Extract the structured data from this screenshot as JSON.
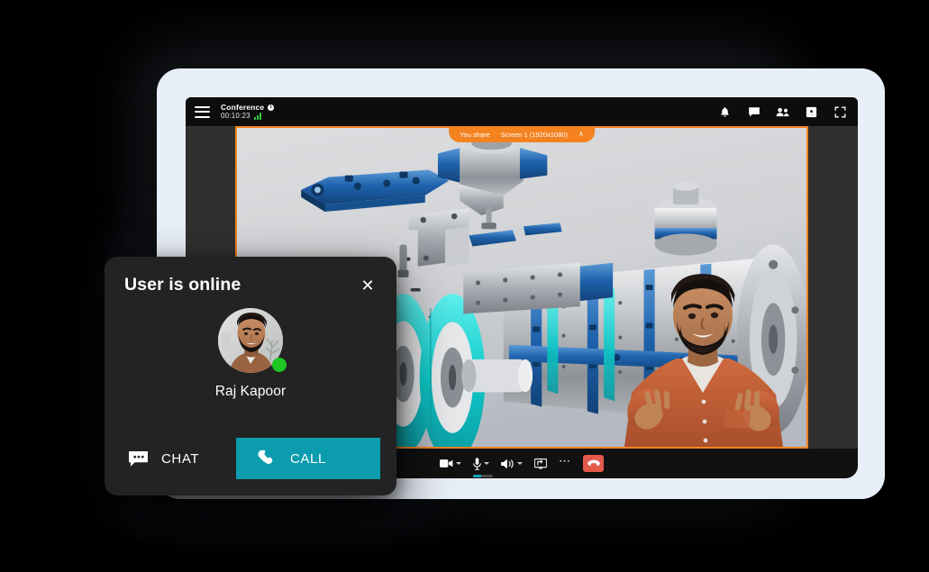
{
  "app": {
    "menu_icon": "hamburger-menu-icon",
    "conference_title": "Conference",
    "info_icon": "info-icon",
    "timer": "00:10:23",
    "signal_icon": "signal-strength-icon",
    "top_actions": [
      {
        "name": "notifications",
        "icon": "bell-icon",
        "label": "Notifications"
      },
      {
        "name": "chat",
        "icon": "chat-bubble-icon",
        "label": "Chat"
      },
      {
        "name": "participants",
        "icon": "people-icon",
        "label": "Participants"
      },
      {
        "name": "record",
        "icon": "record-screen-icon",
        "label": "Record"
      },
      {
        "name": "fullscreen",
        "icon": "fullscreen-icon",
        "label": "Fullscreen"
      }
    ]
  },
  "share": {
    "label": "You share",
    "source": "Screen 1 (1920x1080)",
    "chevron": "∧"
  },
  "controls": [
    {
      "name": "camera",
      "icon": "video-camera-icon",
      "has_caret": true
    },
    {
      "name": "microphone",
      "icon": "microphone-icon",
      "has_caret": true,
      "level": 42
    },
    {
      "name": "speaker",
      "icon": "speaker-icon",
      "has_caret": true
    },
    {
      "name": "share-screen",
      "icon": "screen-share-icon",
      "has_caret": false
    },
    {
      "name": "more-options",
      "icon": "ellipsis-icon",
      "glyph": "•••"
    },
    {
      "name": "hang-up",
      "icon": "phone-hangup-icon",
      "has_caret": false
    }
  ],
  "user_card": {
    "title": "User is online",
    "close_icon": "close-icon",
    "avatar_name": "avatar",
    "status": "online",
    "status_color": "#1fc522",
    "name": "Raj Kapoor",
    "chat_icon": "chat-bubble-icon",
    "chat_label": "CHAT",
    "call_icon": "phone-icon",
    "call_label": "CALL",
    "call_color": "#0b9cae"
  },
  "colors": {
    "accent_orange": "#f4821f",
    "accent_teal": "#0b9cae",
    "hangup_red": "#e5594d",
    "online_green": "#1fc522",
    "app_background": "#0d0d0d",
    "device_shell": "#e9eff8"
  }
}
